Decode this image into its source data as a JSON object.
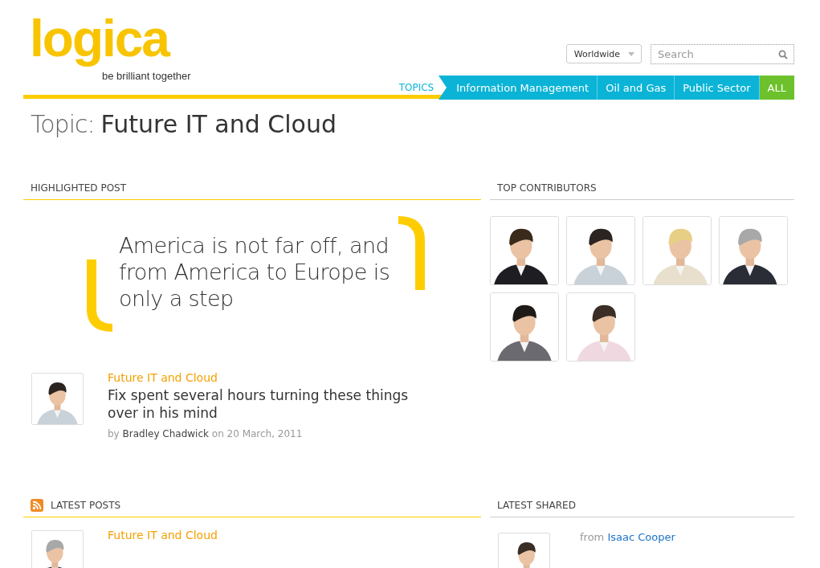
{
  "header": {
    "logo": "logica",
    "tagline": "be brilliant together",
    "region": "Worldwide",
    "search": {
      "placeholder": "Search"
    },
    "topics_label": "TOPICS",
    "topics": [
      {
        "label": "Information Management",
        "kind": "topic"
      },
      {
        "label": "Oil and Gas",
        "kind": "topic"
      },
      {
        "label": "Public Sector",
        "kind": "topic"
      },
      {
        "label": "ALL",
        "kind": "all"
      }
    ]
  },
  "title": {
    "prefix": "Topic:",
    "name": "Future IT and Cloud"
  },
  "highlighted": {
    "heading": "HIGHLIGHTED POST",
    "quote": "America is not far off, and from America to Europe is only a step",
    "post": {
      "category": "Future IT and Cloud",
      "title": "Fix spent several hours turning these things over in his mind",
      "by": "by",
      "author": "Bradley Chadwick",
      "on": "on 20 March, 2011"
    }
  },
  "contributors": {
    "heading": "TOP CONTRIBUTORS"
  },
  "latest_posts": {
    "heading": "LATEST POSTS",
    "posts": [
      {
        "category": "Future IT and Cloud"
      }
    ]
  },
  "latest_shared": {
    "heading": "LATEST SHARED",
    "items": [
      {
        "from": "from",
        "author": "Isaac Cooper"
      }
    ]
  }
}
